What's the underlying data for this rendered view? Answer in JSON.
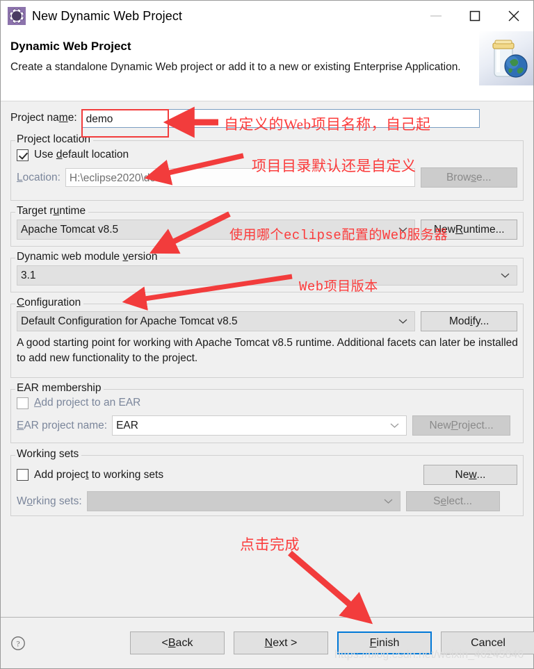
{
  "window": {
    "title": "New Dynamic Web Project",
    "icon": "eclipse-gear-icon",
    "controls": {
      "minimize": "minimize-icon",
      "maximize": "maximize-icon",
      "close": "close-icon"
    }
  },
  "banner": {
    "title": "Dynamic Web Project",
    "description": "Create a standalone Dynamic Web project or add it to a new or existing Enterprise Application.",
    "image": "jar-globe-icon"
  },
  "form": {
    "project_name": {
      "label_before": "Project na",
      "label_mnemonic": "m",
      "label_after": "e:",
      "value": "demo"
    },
    "project_location": {
      "legend": "Project location",
      "use_default": {
        "label_before": "Use ",
        "label_mnemonic": "d",
        "label_after": "efault location",
        "checked": true
      },
      "location": {
        "label_mnemonic": "L",
        "label_after": "ocation:",
        "value": "H:\\eclipse2020\\demo",
        "disabled": true
      },
      "browse_button": {
        "label_before": "Brow",
        "label_mnemonic": "s",
        "label_after": "e...",
        "disabled": true
      }
    },
    "target_runtime": {
      "legend_before": "Target r",
      "legend_mnemonic": "u",
      "legend_after": "ntime",
      "value": "Apache Tomcat v8.5",
      "button_before": "New ",
      "button_mnemonic": "R",
      "button_after": "untime..."
    },
    "module_version": {
      "legend_before": "Dynamic web module ",
      "legend_mnemonic": "v",
      "legend_after": "ersion",
      "value": "3.1"
    },
    "configuration": {
      "legend_mnemonic": "C",
      "legend_after": "onfiguration",
      "value": "Default Configuration for Apache Tomcat v8.5",
      "button_before": "Mod",
      "button_mnemonic": "i",
      "button_after": "fy...",
      "description": "A good starting point for working with Apache Tomcat v8.5 runtime. Additional facets can later be installed to add new functionality to the project."
    },
    "ear_membership": {
      "legend": "EAR membership",
      "add_to_ear": {
        "label_mnemonic": "A",
        "label_after": "dd project to an EAR",
        "checked": false,
        "disabled": true
      },
      "ear_project_name": {
        "label_mnemonic": "E",
        "label_after": "AR project name:",
        "value": "EAR",
        "disabled": true
      },
      "new_project_button": {
        "label_before": "New ",
        "label_mnemonic": "P",
        "label_after": "roject...",
        "disabled": true
      }
    },
    "working_sets": {
      "legend": "Working sets",
      "add_to_working_sets": {
        "label_before": "Add projec",
        "label_mnemonic": "t",
        "label_after": " to working sets",
        "checked": false
      },
      "new_button": {
        "label_before": "Ne",
        "label_mnemonic": "w",
        "label_after": "..."
      },
      "working_sets_field": {
        "label_before": "W",
        "label_mnemonic": "o",
        "label_after": "rking sets:",
        "value": "",
        "disabled": true
      },
      "select_button": {
        "label_before": "S",
        "label_mnemonic": "e",
        "label_after": "lect...",
        "disabled": true
      }
    }
  },
  "footer": {
    "help": "help-icon",
    "back": {
      "before": "< ",
      "mnemonic": "B",
      "after": "ack"
    },
    "next": {
      "before": "",
      "mnemonic": "N",
      "after": "ext >"
    },
    "finish": {
      "before": "",
      "mnemonic": "F",
      "after": "inish"
    },
    "cancel": {
      "before": "Cancel",
      "mnemonic": "",
      "after": ""
    }
  },
  "annotations": {
    "project_name_note": "自定义的Web项目名称，自己起",
    "location_note": "项目目录默认还是自定义",
    "runtime_note": "使用哪个eclipse配置的Web服务器",
    "version_note": "Web项目版本",
    "finish_note": "点击完成"
  },
  "watermark": "https://blog.csdn.net/weixin_46245846",
  "colors": {
    "annotation_red": "#fb3b3b",
    "focus_blue": "#0078d7",
    "dialog_bg": "#f0f0f0",
    "title_icon_purple": "#8c73ac"
  }
}
